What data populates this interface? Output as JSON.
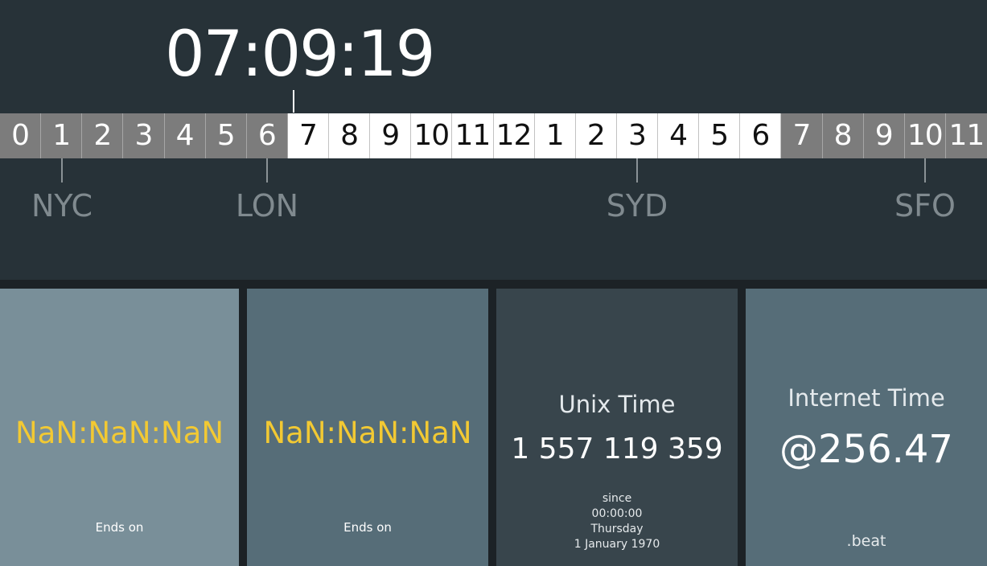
{
  "clock": {
    "time": "07:09:19"
  },
  "timeline": {
    "hours": [
      {
        "label": "0",
        "daylight": false
      },
      {
        "label": "1",
        "daylight": false
      },
      {
        "label": "2",
        "daylight": false
      },
      {
        "label": "3",
        "daylight": false
      },
      {
        "label": "4",
        "daylight": false
      },
      {
        "label": "5",
        "daylight": false
      },
      {
        "label": "6",
        "daylight": false
      },
      {
        "label": "7",
        "daylight": true
      },
      {
        "label": "8",
        "daylight": true
      },
      {
        "label": "9",
        "daylight": true
      },
      {
        "label": "10",
        "daylight": true
      },
      {
        "label": "11",
        "daylight": true
      },
      {
        "label": "12",
        "daylight": true
      },
      {
        "label": "1",
        "daylight": true
      },
      {
        "label": "2",
        "daylight": true
      },
      {
        "label": "3",
        "daylight": true
      },
      {
        "label": "4",
        "daylight": true
      },
      {
        "label": "5",
        "daylight": true
      },
      {
        "label": "6",
        "daylight": true
      },
      {
        "label": "7",
        "daylight": false
      },
      {
        "label": "8",
        "daylight": false
      },
      {
        "label": "9",
        "daylight": false
      },
      {
        "label": "10",
        "daylight": false
      },
      {
        "label": "11",
        "daylight": false
      }
    ],
    "cities": [
      {
        "label": "NYC",
        "hour_index": 1
      },
      {
        "label": "LON",
        "hour_index": 6
      },
      {
        "label": "SYD",
        "hour_index": 15
      },
      {
        "label": "SFO",
        "hour_index": 22
      }
    ]
  },
  "panels": {
    "countdown_1": {
      "value": "NaN:NaN:NaN",
      "footer": "Ends on"
    },
    "countdown_2": {
      "value": "NaN:NaN:NaN",
      "footer": "Ends on"
    },
    "unix": {
      "title": "Unix Time",
      "value": "1 557 119 359",
      "since_lines": [
        "since",
        "00:00:00",
        "Thursday",
        "1 January 1970"
      ]
    },
    "internet": {
      "title": "Internet Time",
      "value": "@256.47",
      "unit": ".beat"
    }
  },
  "colors": {
    "background": "#273238",
    "night_hour": "#7c7c7c",
    "day_hour": "#ffffff",
    "countdown_accent": "#f2c933"
  }
}
